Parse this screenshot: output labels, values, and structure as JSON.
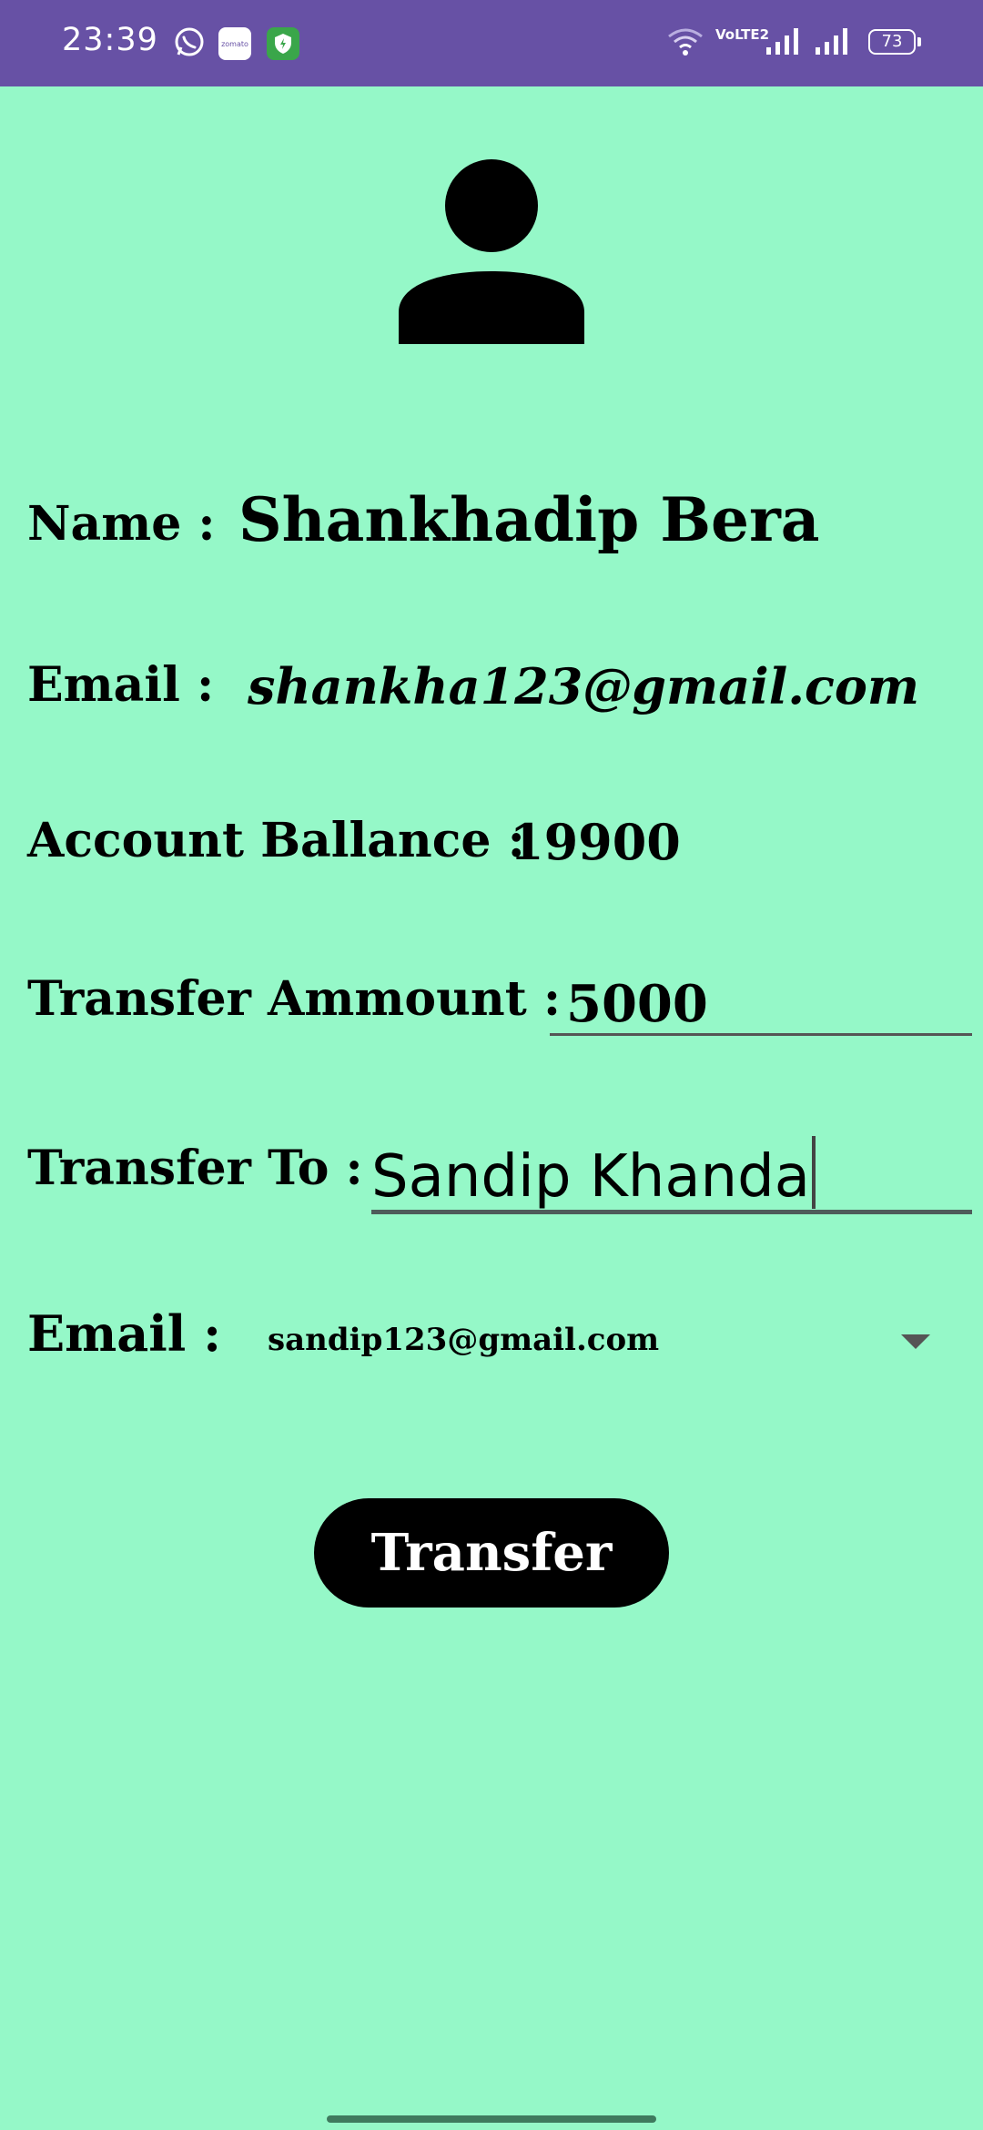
{
  "status_bar": {
    "time": "23:39",
    "notif_app_label": "zomato",
    "network_label": "VoLTE2",
    "battery": "73"
  },
  "profile": {
    "name_label": "Name :",
    "name_value": "Shankhadip Bera",
    "email_label": "Email :",
    "email_value": "shankha123@gmail.com",
    "balance_label": "Account Ballance :",
    "balance_value": "19900"
  },
  "transfer": {
    "amount_label": "Transfer Ammount :",
    "amount_value": "5000",
    "to_label": "Transfer To :",
    "to_value": "Sandip Khanda",
    "email_label": "Email :",
    "email_selected": "sandip123@gmail.com",
    "button_label": "Transfer"
  },
  "colors": {
    "background": "#95f8c8",
    "status_bar": "#6751a5",
    "button": "#000000"
  }
}
